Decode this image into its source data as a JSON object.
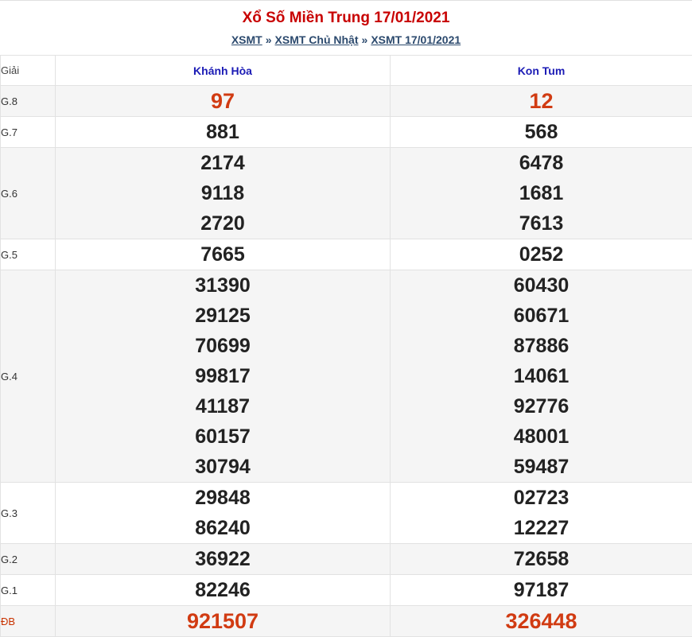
{
  "header": {
    "title": "Xổ Số Miền Trung 17/01/2021",
    "breadcrumb": [
      {
        "label": "XSMT"
      },
      {
        "label": "XSMT Chủ Nhật"
      },
      {
        "label": "XSMT 17/01/2021"
      }
    ],
    "separator": "»"
  },
  "table": {
    "label_header": "Giải",
    "provinces": [
      "Khánh Hòa",
      "Kon Tum"
    ],
    "prizes": [
      {
        "label": "G.8",
        "highlight": true,
        "values": [
          [
            "97"
          ],
          [
            "12"
          ]
        ]
      },
      {
        "label": "G.7",
        "values": [
          [
            "881"
          ],
          [
            "568"
          ]
        ]
      },
      {
        "label": "G.6",
        "values": [
          [
            "2174",
            "9118",
            "2720"
          ],
          [
            "6478",
            "1681",
            "7613"
          ]
        ]
      },
      {
        "label": "G.5",
        "values": [
          [
            "7665"
          ],
          [
            "0252"
          ]
        ]
      },
      {
        "label": "G.4",
        "values": [
          [
            "31390",
            "29125",
            "70699",
            "99817",
            "41187",
            "60157",
            "30794"
          ],
          [
            "60430",
            "60671",
            "87886",
            "14061",
            "92776",
            "48001",
            "59487"
          ]
        ]
      },
      {
        "label": "G.3",
        "values": [
          [
            "29848",
            "86240"
          ],
          [
            "02723",
            "12227"
          ]
        ]
      },
      {
        "label": "G.2",
        "values": [
          [
            "36922"
          ],
          [
            "72658"
          ]
        ]
      },
      {
        "label": "G.1",
        "values": [
          [
            "82246"
          ],
          [
            "97187"
          ]
        ]
      },
      {
        "label": "ĐB",
        "highlight": true,
        "special": true,
        "values": [
          [
            "921507"
          ],
          [
            "326448"
          ]
        ]
      }
    ]
  },
  "colors": {
    "title": "#c80000",
    "link": "#2c4a6e",
    "province": "#1b1bb5",
    "highlight_number": "#d13b12"
  }
}
